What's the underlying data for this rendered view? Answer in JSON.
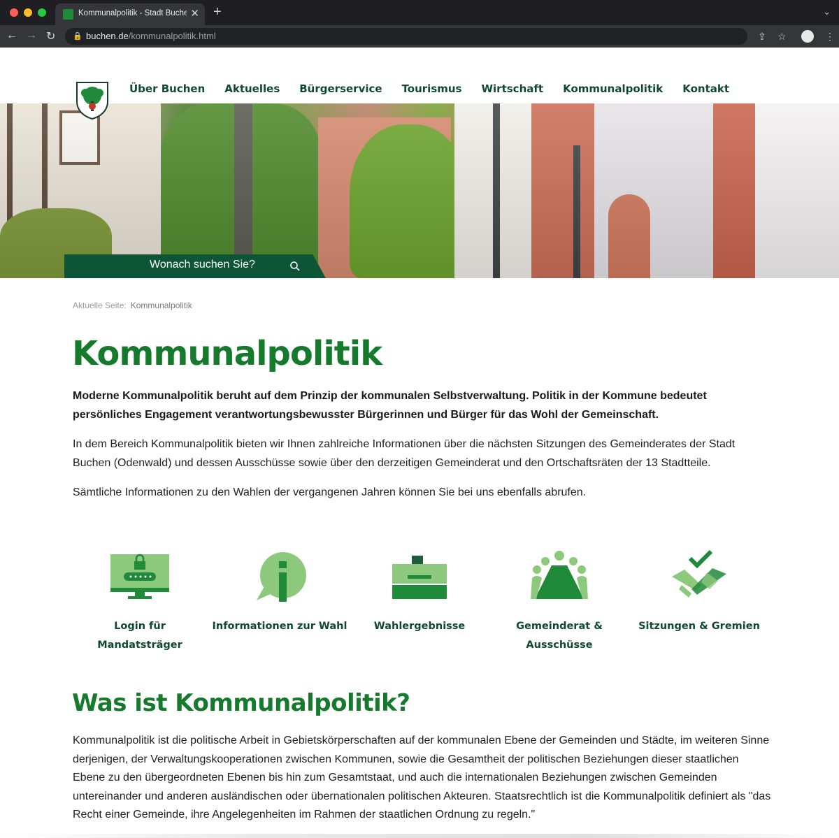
{
  "browser": {
    "tab_title": "Kommunalpolitik - Stadt Buchen",
    "new_tab": "+",
    "close_tab": "✕",
    "tab_menu": "⌄",
    "url_host": "buchen.de",
    "url_path": "/kommunalpolitik.html",
    "back": "←",
    "forward": "→",
    "reload": "↻"
  },
  "nav": {
    "items": [
      "Über Buchen",
      "Aktuelles",
      "Bürgerservice",
      "Tourismus",
      "Wirtschaft",
      "Kommunalpolitik",
      "Kontakt"
    ]
  },
  "search": {
    "placeholder": "Wonach suchen Sie?"
  },
  "breadcrumb": {
    "label": "Aktuelle Seite:",
    "current": "Kommunalpolitik"
  },
  "main": {
    "title": "Kommunalpolitik",
    "lead": "Moderne Kommunalpolitik beruht auf dem Prinzip der kommunalen Selbstverwaltung. Politik in der Kommune bedeutet persönliches Engagement verantwortungsbewusster Bürgerinnen und Bürger für das Wohl der Gemeinschaft.",
    "para1": "In dem Bereich Kommunalpolitik bieten wir Ihnen zahlreiche Informationen über die nächsten Sitzungen des Gemeinderates der Stadt Buchen (Odenwald) und dessen Ausschüsse sowie über den derzeitigen Gemeinderat und den Ortschaftsräten der 13 Stadtteile.",
    "para2": "Sämtliche Informationen zu den Wahlen der vergangenen Jahren können Sie bei uns ebenfalls abrufen."
  },
  "tiles": [
    {
      "label": "Login für Mandatsträger",
      "icon": "monitor-lock-icon"
    },
    {
      "label": "Informationen zur Wahl",
      "icon": "info-bubble-icon"
    },
    {
      "label": "Wahlergebnisse",
      "icon": "ballot-box-icon"
    },
    {
      "label": "Gemeinderat & Ausschüsse",
      "icon": "meeting-table-icon"
    },
    {
      "label": "Sitzungen & Gremien",
      "icon": "handshake-check-icon"
    }
  ],
  "section": {
    "heading": "Was ist Kommunalpolitik?",
    "text": "Kommunalpolitik ist die politische Arbeit in Gebietskörperschaften auf der kommunalen Ebene der Gemeinden und Städte, im weiteren Sinne derjenigen, der Verwaltungskooperationen zwischen Kommunen, sowie die Gesamtheit der politischen Beziehungen dieser staatlichen Ebene zu den übergeordneten Ebenen bis hin zum Gesamtstaat, und auch die internationalen Beziehungen zwischen Gemeinden untereinander und anderen ausländischen oder übernationalen politischen Akteuren. Staatsrechtlich ist die Kommunalpolitik definiert als \"das Recht einer Gemeinde, ihre Angelegenheiten im Rahmen der staatlichen Ordnung zu regeln.\""
  },
  "colors": {
    "brand_green": "#157a2c",
    "nav_text": "#0f4a2e",
    "search_bg": "#0e5537",
    "icon_light": "#8cc97c",
    "icon_dark": "#1e8a3a"
  }
}
